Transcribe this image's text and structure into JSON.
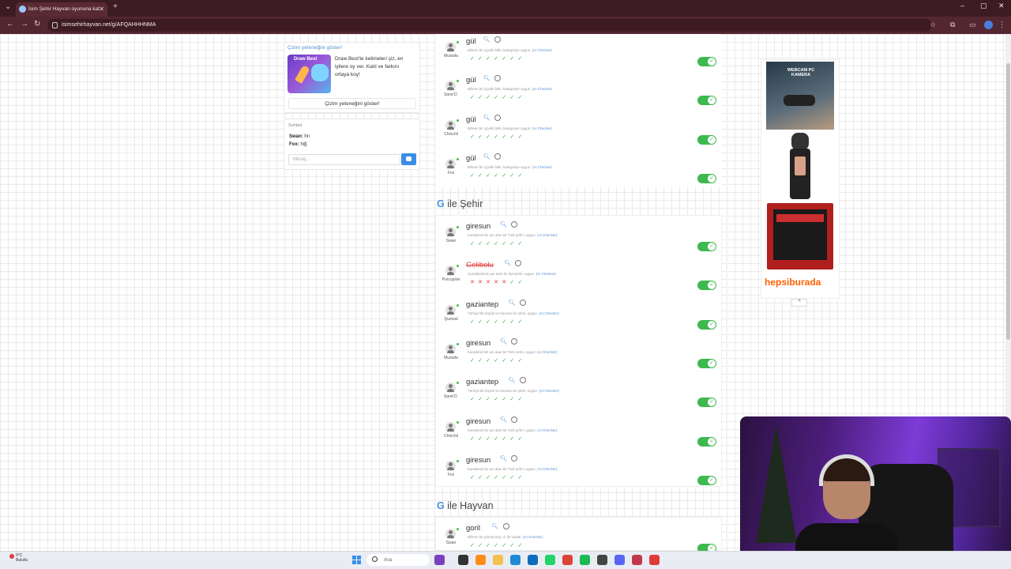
{
  "browser": {
    "tab_title": "İsim Şehir Hayvan oyununa kat",
    "new_tab": "+",
    "url": "isimsehirhayvan.net/g/AFQAHHHNMA"
  },
  "sidebar": {
    "draw_title": "Çizim yeteneğini göster!",
    "draw_img_text": "Draw Best",
    "draw_text": "Draw Best'te kelimeleri çiz, en iyilere oy ver. Katıl ve farkını ortaya koy!",
    "draw_button": "Çizim yeteneğini göster!",
    "chat_title": "Sohbet",
    "chat": [
      {
        "user": "Swan:",
        "msg": "hrı"
      },
      {
        "user": "Fox:",
        "msg": "hiğ"
      }
    ],
    "chat_placeholder": "Mesaj..."
  },
  "section_prev_rows": [
    {
      "player": "Mustafa",
      "answer": "gül",
      "hint": "Bilinen bir çiçekli bitki, kategoriye uygun.",
      "ai": "(AI Checker)"
    },
    {
      "player": "Sand D.",
      "answer": "gül",
      "hint": "Bilinen bir çiçekli bitki, kategoriye uygun.",
      "ai": "(AI Checker)"
    },
    {
      "player": "Chinchil",
      "answer": "gül",
      "hint": "Bilinen bir çiçekli bitki, kategoriye uygun.",
      "ai": "(AI Checker)"
    },
    {
      "player": "Fox",
      "answer": "gül",
      "hint": "Bilinen bir çiçekli bitki, kategoriye uygun.",
      "ai": "(AI Checker)"
    }
  ],
  "city_section": {
    "letter": "G",
    "title": " ile Şehir",
    "rows": [
      {
        "player": "Swan",
        "answer": "giresun",
        "hint": "Karadeniz'de yer alan bir Türk şehri, uygun.",
        "ai": "(AI Checker)"
      },
      {
        "player": "Porcupine",
        "answer": "Gelibolu",
        "hint": "Çanakkale'de yer alan bir ilçe/şehir, uygun.",
        "ai": "(AI Checker)",
        "rejected": true
      },
      {
        "player": "Quetzal",
        "answer": "gaziantep",
        "hint": "Türkiye'de büyük ve tanınan bir şehir, uygun.",
        "ai": "(AI Checker)"
      },
      {
        "player": "Mustafa",
        "answer": "giresun",
        "hint": "Karadeniz'de yer alan bir Türk şehri, uygun.",
        "ai": "(AI Checker)"
      },
      {
        "player": "Sand D.",
        "answer": "gaziantep",
        "hint": "Türkiye'de büyük ve tanınan bir şehir, uygun.",
        "ai": "(AI Checker)"
      },
      {
        "player": "Chinchil",
        "answer": "giresun",
        "hint": "Karadeniz'de yer alan bir Türk şehri, uygun.",
        "ai": "(AI Checker)"
      },
      {
        "player": "Fox",
        "answer": "giresun",
        "hint": "Karadeniz'de yer alan bir Türk şehri, uygun.",
        "ai": "(AI Checker)"
      }
    ]
  },
  "animal_section": {
    "letter": "G",
    "title": " ile Hayvan",
    "rows": [
      {
        "player": "Swan",
        "answer": "goril",
        "hint": "Bilinen bir primat türü, G ile başlar.",
        "ai": "(AI Checker)"
      }
    ]
  },
  "ad": {
    "img1_text": "WEBCAM PC KAMERA",
    "brand": "hepsiburada",
    "collapse": "^"
  },
  "taskbar": {
    "temp": "9°C",
    "weather": "Bulutlu",
    "search_placeholder": "Ara"
  },
  "colors": {
    "accent": "#4a90d9",
    "ok": "#40b14d",
    "reject": "#e03a3a",
    "toggle": "#3eb94f",
    "brand": "#ff6000"
  }
}
